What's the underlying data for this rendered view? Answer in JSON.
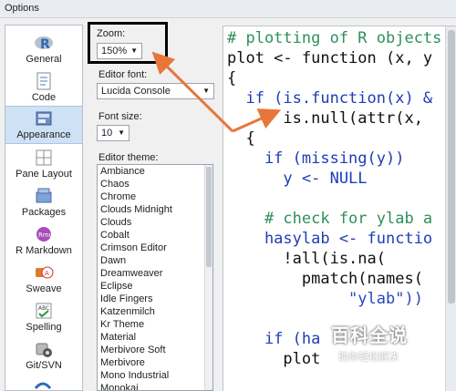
{
  "window": {
    "title": "Options"
  },
  "sidebar": {
    "items": [
      {
        "label": "General",
        "icon": "r-logo-icon"
      },
      {
        "label": "Code",
        "icon": "code-icon"
      },
      {
        "label": "Appearance",
        "icon": "appearance-icon",
        "active": true
      },
      {
        "label": "Pane Layout",
        "icon": "pane-layout-icon"
      },
      {
        "label": "Packages",
        "icon": "packages-icon"
      },
      {
        "label": "R Markdown",
        "icon": "rmarkdown-icon"
      },
      {
        "label": "Sweave",
        "icon": "sweave-icon"
      },
      {
        "label": "Spelling",
        "icon": "spelling-icon"
      },
      {
        "label": "Git/SVN",
        "icon": "git-icon"
      }
    ]
  },
  "settings": {
    "zoom_label": "Zoom:",
    "zoom_value": "150%",
    "editor_font_label": "Editor font:",
    "editor_font_value": "Lucida Console",
    "font_size_label": "Font size:",
    "font_size_value": "10",
    "editor_theme_label": "Editor theme:",
    "themes": [
      "Ambiance",
      "Chaos",
      "Chrome",
      "Clouds Midnight",
      "Clouds",
      "Cobalt",
      "Crimson Editor",
      "Dawn",
      "Dreamweaver",
      "Eclipse",
      "Idle Fingers",
      "Katzenmilch",
      "Kr Theme",
      "Material",
      "Merbivore Soft",
      "Merbivore",
      "Mono Industrial",
      "Monokai"
    ]
  },
  "preview": {
    "lines": [
      {
        "text": "# plotting of R objects",
        "kind": "comment"
      },
      {
        "text": "plot <- function (x, y",
        "kind": "def"
      },
      {
        "text": "{",
        "kind": "def"
      },
      {
        "text": "  if (is.function(x) &",
        "kind": "kw"
      },
      {
        "text": "      is.null(attr(x,",
        "kind": "def"
      },
      {
        "text": "  {",
        "kind": "def"
      },
      {
        "text": "    if (missing(y))",
        "kind": "kw"
      },
      {
        "text": "      y <- NULL",
        "kind": "kw"
      },
      {
        "text": "",
        "kind": "def"
      },
      {
        "text": "    # check for ylab a",
        "kind": "comment"
      },
      {
        "text": "    hasylab <- functio",
        "kind": "kw"
      },
      {
        "text": "      !all(is.na(",
        "kind": "def"
      },
      {
        "text": "        pmatch(names(",
        "kind": "def"
      },
      {
        "text": "             \"ylab\"))",
        "kind": "str"
      },
      {
        "text": "",
        "kind": "def"
      },
      {
        "text": "    if (ha",
        "kind": "kw"
      },
      {
        "text": "      plot",
        "kind": "def"
      }
    ]
  },
  "watermark": {
    "title": "百科全说",
    "subtitle": "助你轻松解决"
  },
  "colors": {
    "accent": "#e8763a",
    "selection": "#cfe1f4",
    "highlight_border": "#000000"
  }
}
